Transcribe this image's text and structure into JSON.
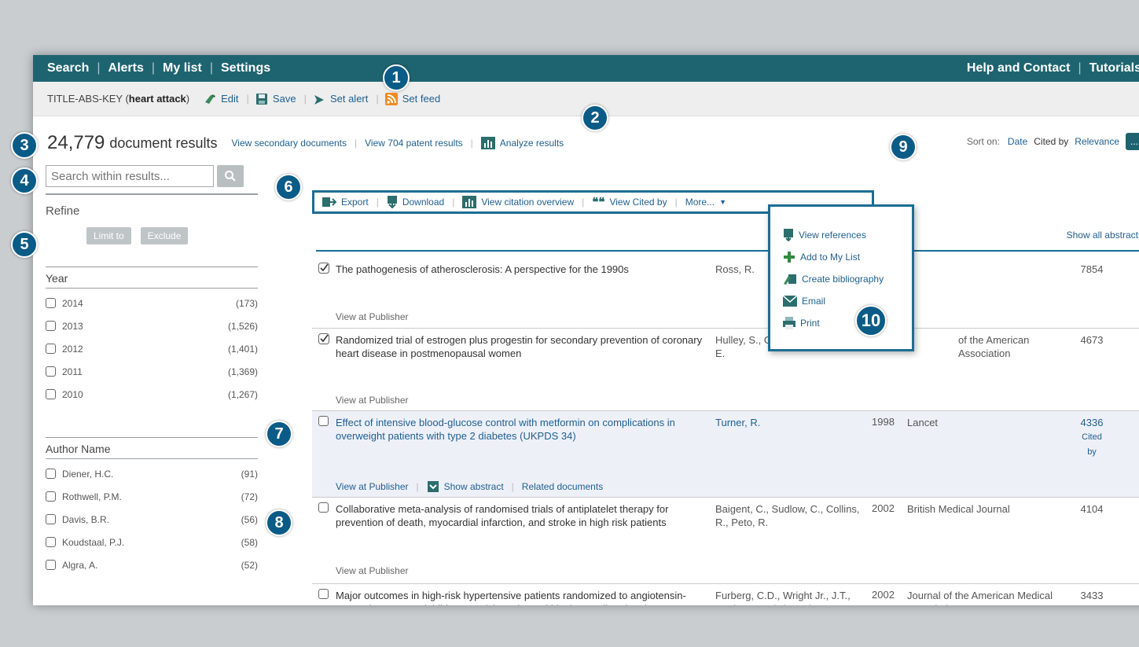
{
  "topnav": {
    "left": [
      "Search",
      "Alerts",
      "My list",
      "Settings"
    ],
    "right": [
      "Help and Contact",
      "Tutorials"
    ]
  },
  "querybar": {
    "query_prefix": "TITLE-ABS-KEY (",
    "query_term": "heart attack",
    "query_suffix": ")",
    "actions": [
      "Edit",
      "Save",
      "Set alert",
      "Set feed"
    ]
  },
  "results_header": {
    "count": "24,779",
    "count_label": "document results",
    "links": [
      "View secondary documents",
      "View 704 patent results",
      "Analyze results"
    ],
    "sort_label": "Sort on:",
    "sort_options": [
      "Date",
      "Cited by",
      "Relevance"
    ],
    "sort_button": "..."
  },
  "sidebar": {
    "search_placeholder": "Search within results...",
    "refine_label": "Refine",
    "limit_label": "Limit to",
    "exclude_label": "Exclude",
    "year": {
      "heading": "Year",
      "items": [
        {
          "label": "2014",
          "count": "(173)"
        },
        {
          "label": "2013",
          "count": "(1,526)"
        },
        {
          "label": "2012",
          "count": "(1,401)"
        },
        {
          "label": "2011",
          "count": "(1,369)"
        },
        {
          "label": "2010",
          "count": "(1,267)"
        }
      ]
    },
    "author": {
      "heading": "Author Name",
      "items": [
        {
          "label": "Diener, H.C.",
          "count": "(91)"
        },
        {
          "label": "Rothwell, P.M.",
          "count": "(72)"
        },
        {
          "label": "Davis, B.R.",
          "count": "(56)"
        },
        {
          "label": "Koudstaal, P.J.",
          "count": "(58)"
        },
        {
          "label": "Algra, A.",
          "count": "(52)"
        }
      ]
    }
  },
  "toolbar": {
    "items": [
      "Export",
      "Download",
      "View citation overview",
      "View Cited by",
      "More..."
    ],
    "show_all": "Show all abstracts"
  },
  "results": [
    {
      "checked": true,
      "title": "The pathogenesis of atherosclerosis: A perspective for the 1990s",
      "authors": "Ross, R.",
      "year": "",
      "source": "",
      "cited": "7854",
      "actions": [
        "View at Publisher"
      ]
    },
    {
      "checked": true,
      "title": "Randomized trial of estrogen plus progestin for secondary prevention of coronary heart disease in postmenopausal women",
      "authors": "Hulley, S., Grad T., (...), Riggs, E E.",
      "year": "",
      "source": "of the American Association",
      "cited": "4673",
      "actions": [
        "View at Publisher"
      ]
    },
    {
      "checked": false,
      "title": "Effect of intensive blood-glucose control with metformin on complications in overweight patients with type 2 diabetes (UKPDS 34)",
      "authors": "Turner, R.",
      "year": "1998",
      "source": "Lancet",
      "cited": "4336",
      "cited_sub": "Cited by",
      "actions": [
        "View at Publisher",
        "Show abstract",
        "Related documents"
      ]
    },
    {
      "checked": false,
      "title": "Collaborative meta-analysis of randomised trials of antiplatelet therapy for prevention of death, myocardial infarction, and stroke in high risk patients",
      "authors": "Baigent, C., Sudlow, C., Collins, R., Peto, R.",
      "year": "2002",
      "source": "British Medical Journal",
      "cited": "4104",
      "actions": [
        "View at Publisher"
      ]
    },
    {
      "checked": false,
      "title": "Major outcomes in high-risk hypertensive patients randomized to angiotensin-converting enzyme inhibitor or calcium channel blocker vs diuretic: The antihypertensive and lipid-lowering treatment to",
      "authors": "Furberg, C.D., Wright Jr., J.T., Davis, B.R., (...), Cutler, R., Pelosi, J.",
      "year": "2002",
      "source": "Journal of the American Medical Association",
      "cited": "3433",
      "actions": []
    }
  ],
  "more_menu": {
    "items": [
      {
        "label": "View references",
        "icon": "document-icon"
      },
      {
        "label": "Add to My List",
        "icon": "plus-icon"
      },
      {
        "label": "Create bibliography",
        "icon": "bibliography-icon"
      },
      {
        "label": "Email",
        "icon": "email-icon"
      },
      {
        "label": "Print",
        "icon": "print-icon"
      }
    ]
  },
  "callouts": [
    "1",
    "2",
    "3",
    "4",
    "5",
    "6",
    "7",
    "8",
    "9",
    "10"
  ],
  "colors": {
    "nav_bg": "#1e6470",
    "link": "#1e5f8f",
    "callout": "#0b5b87",
    "highlight_border": "#1d6d93"
  }
}
